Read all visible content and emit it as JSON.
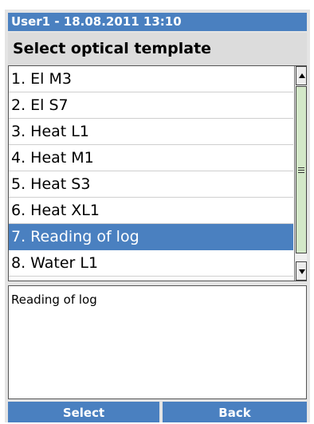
{
  "header": {
    "text": "User1 - 18.08.2011 13:10"
  },
  "title": "Select optical template",
  "list": {
    "items": [
      "1. El M3",
      "2. El S7",
      "3. Heat L1",
      "4. Heat M1",
      "5. Heat S3",
      "6. Heat XL1",
      "7. Reading of log",
      "8. Water L1"
    ],
    "selected_index": 6
  },
  "description": "Reading of log",
  "buttons": {
    "select": "Select",
    "back": "Back"
  },
  "colors": {
    "accent": "#4a80c0",
    "scroll_thumb": "#d3e8c8"
  },
  "icons": {
    "scroll_up": "triangle-up",
    "scroll_down": "triangle-down",
    "scroll_grip": "three-lines"
  }
}
